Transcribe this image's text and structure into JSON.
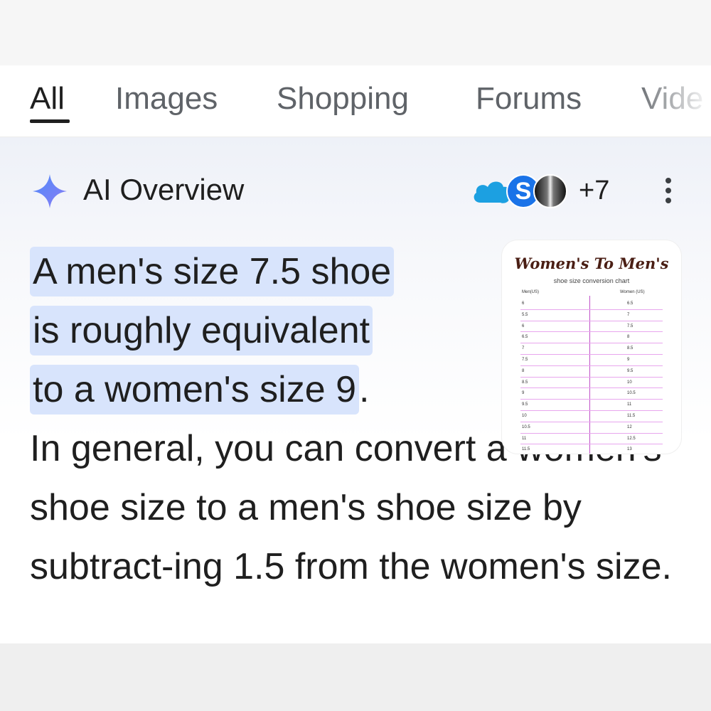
{
  "tabs": [
    {
      "label": "All",
      "active": true
    },
    {
      "label": "Images",
      "active": false
    },
    {
      "label": "Shopping",
      "active": false
    },
    {
      "label": "Forums",
      "active": false
    },
    {
      "label": "Vide",
      "active": false
    }
  ],
  "ai_overview": {
    "title": "AI Overview",
    "sources_more": "+7",
    "source_icons": [
      "salesforce-cloud-icon",
      "s-logo-icon",
      "h-logo-icon"
    ],
    "answer_lines": [
      "A men's size 7.5 shoe",
      "is roughly equivalent",
      "to a women's size 9"
    ],
    "answer_end": ".",
    "followup": "In general, you can convert a women's shoe size to a men's shoe size by subtract-ing 1.5 from the women's size."
  },
  "thumbnail": {
    "title": "Women's To Men's",
    "subtitle": "shoe size conversion chart",
    "col_men": "Men(US)",
    "col_women": "Women (US)",
    "rows": [
      {
        "men": "6",
        "women": "6.5"
      },
      {
        "men": "5.5",
        "women": "7"
      },
      {
        "men": "6",
        "women": "7.5"
      },
      {
        "men": "6.5",
        "women": "8"
      },
      {
        "men": "7",
        "women": "8.5"
      },
      {
        "men": "7.5",
        "women": "9"
      },
      {
        "men": "8",
        "women": "9.5"
      },
      {
        "men": "8.5",
        "women": "10"
      },
      {
        "men": "9",
        "women": "10.5"
      },
      {
        "men": "9.5",
        "women": "11"
      },
      {
        "men": "10",
        "women": "11.5"
      },
      {
        "men": "10.5",
        "women": "12"
      },
      {
        "men": "11",
        "women": "12.5"
      },
      {
        "men": "11.5",
        "women": "13"
      }
    ]
  },
  "colors": {
    "accent_blue": "#1a73e8",
    "highlight": "#d8e4fc",
    "text_primary": "#1f1f1f",
    "text_secondary": "#5f6368",
    "chart_pink": "#e8a6ee",
    "chart_title": "#4a1e14"
  }
}
